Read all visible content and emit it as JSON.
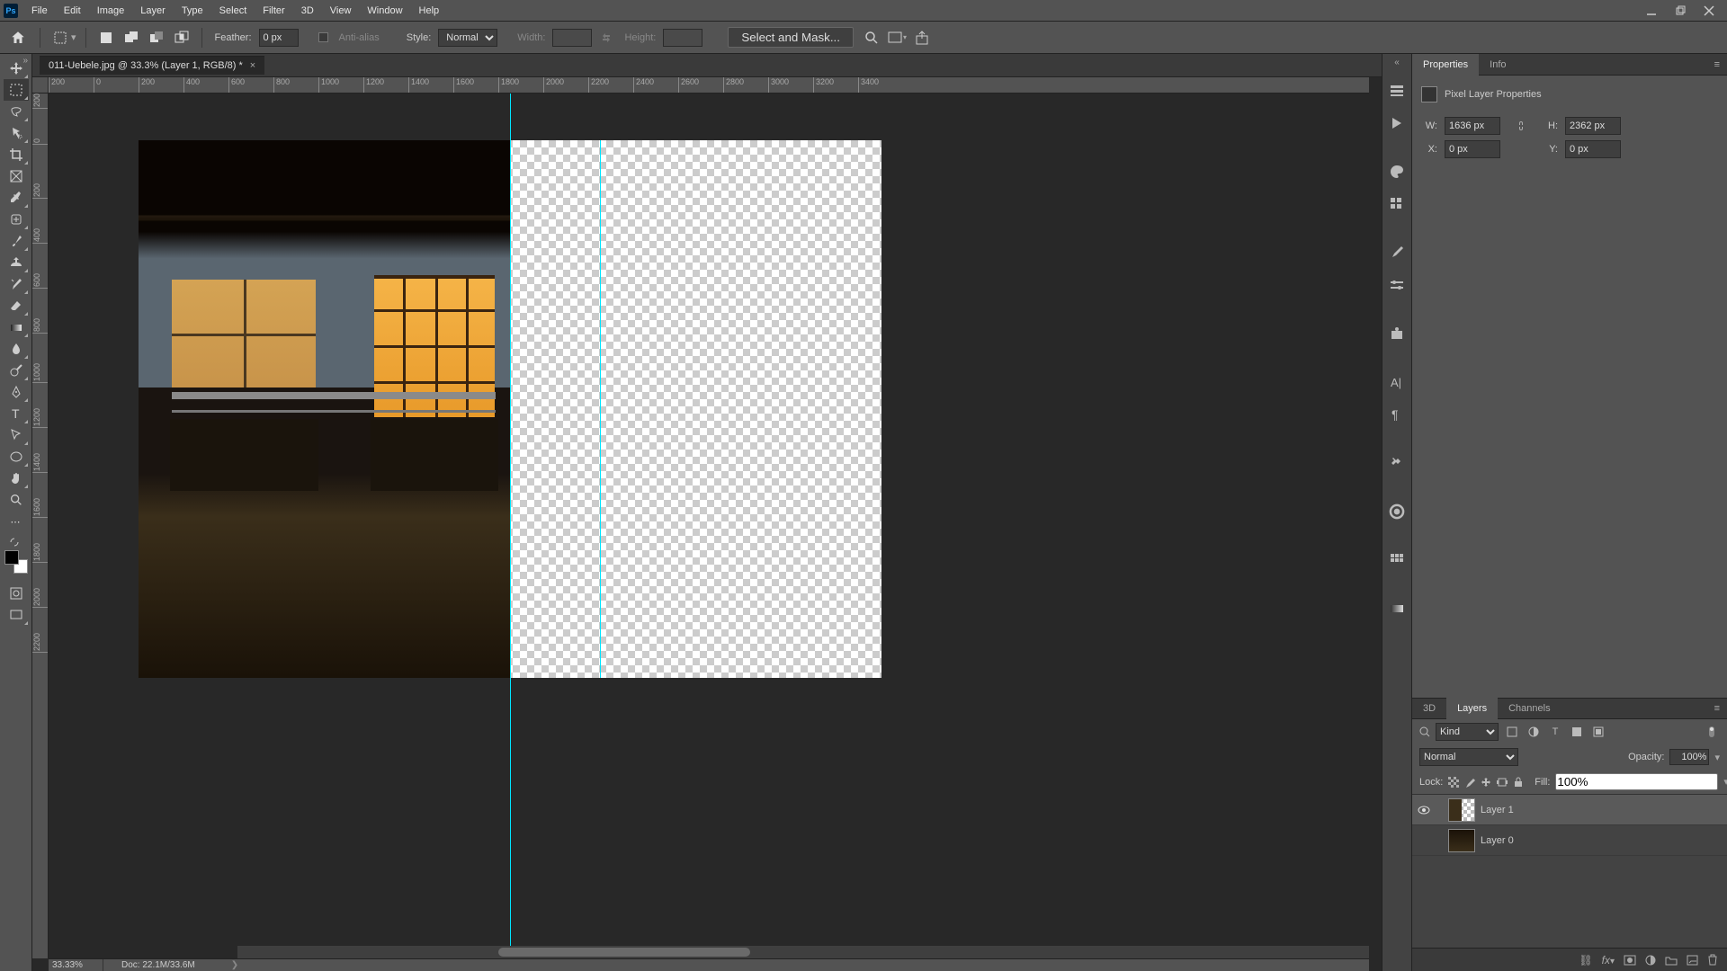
{
  "menu": {
    "items": [
      "File",
      "Edit",
      "Image",
      "Layer",
      "Type",
      "Select",
      "Filter",
      "3D",
      "View",
      "Window",
      "Help"
    ]
  },
  "options": {
    "feather_label": "Feather:",
    "feather_value": "0 px",
    "antialias_label": "Anti-alias",
    "style_label": "Style:",
    "style_value": "Normal",
    "width_label": "Width:",
    "height_label": "Height:",
    "select_mask": "Select and Mask..."
  },
  "document": {
    "tab_title": "011-Uebele.jpg @ 33.3% (Layer 1, RGB/8) *",
    "zoom": "33.33%",
    "doc_info": "Doc: 22.1M/33.6M"
  },
  "ruler_h": [
    "200",
    "0",
    "200",
    "400",
    "600",
    "800",
    "1000",
    "1200",
    "1400",
    "1600",
    "1800",
    "2000",
    "2200",
    "2400",
    "2600",
    "2800",
    "3000",
    "3200",
    "3400"
  ],
  "ruler_v": [
    "200",
    "0",
    "200",
    "400",
    "600",
    "800",
    "1000",
    "1200",
    "1400",
    "1600",
    "1800",
    "2000",
    "2200"
  ],
  "panels": {
    "properties": {
      "tab": "Properties",
      "info_tab": "Info",
      "title": "Pixel Layer Properties",
      "w_label": "W:",
      "w_value": "1636 px",
      "h_label": "H:",
      "h_value": "2362 px",
      "x_label": "X:",
      "x_value": "0 px",
      "y_label": "Y:",
      "y_value": "0 px"
    },
    "layers": {
      "tab_3d": "3D",
      "tab_layers": "Layers",
      "tab_channels": "Channels",
      "kind": "Kind",
      "blend": "Normal",
      "opacity_label": "Opacity:",
      "opacity_value": "100%",
      "lock_label": "Lock:",
      "fill_label": "Fill:",
      "fill_value": "100%",
      "items": [
        {
          "name": "Layer 1",
          "visible": true,
          "selected": true
        },
        {
          "name": "Layer 0",
          "visible": false,
          "selected": false
        }
      ]
    }
  }
}
